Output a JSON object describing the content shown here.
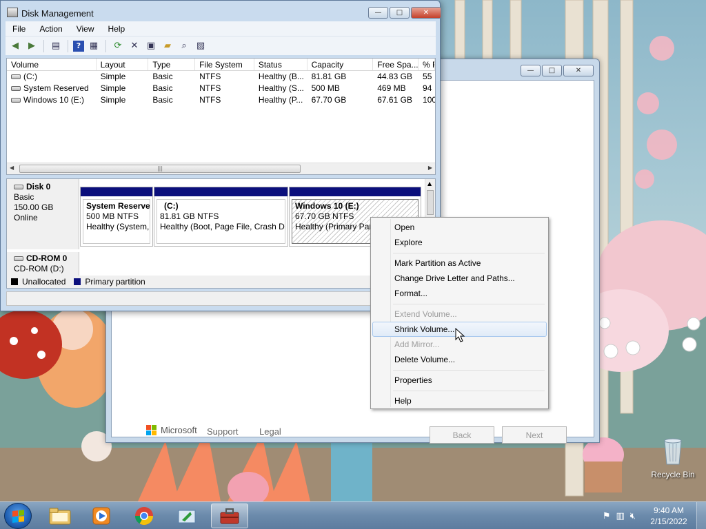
{
  "disk_mgmt": {
    "title": "Disk Management",
    "menu": [
      "File",
      "Action",
      "View",
      "Help"
    ],
    "columns": [
      "Volume",
      "Layout",
      "Type",
      "File System",
      "Status",
      "Capacity",
      "Free Spa...",
      "% F"
    ],
    "volumes": [
      [
        "(C:)",
        "Simple",
        "Basic",
        "NTFS",
        "Healthy (B...",
        "81.81 GB",
        "44.83 GB",
        "55"
      ],
      [
        "System Reserved",
        "Simple",
        "Basic",
        "NTFS",
        "Healthy (S...",
        "500 MB",
        "469 MB",
        "94"
      ],
      [
        "Windows 10 (E:)",
        "Simple",
        "Basic",
        "NTFS",
        "Healthy (P...",
        "67.70 GB",
        "67.61 GB",
        "100"
      ]
    ],
    "disk0": {
      "name": "Disk 0",
      "type": "Basic",
      "size": "150.00 GB",
      "state": "Online",
      "partitions": [
        {
          "name": "System Reserve",
          "info": "500 MB NTFS",
          "status": "Healthy (System,"
        },
        {
          "name": "(C:)",
          "info": "81.81 GB NTFS",
          "status": "Healthy (Boot, Page File, Crash Du"
        },
        {
          "name": "Windows 10  (E:)",
          "info": "67.70 GB NTFS",
          "status": "Healthy (Primary Part"
        }
      ]
    },
    "cdrom": {
      "name": "CD-ROM 0",
      "drive": "CD-ROM (D:)"
    },
    "legend": {
      "unallocated": "Unallocated",
      "primary": "Primary partition"
    },
    "colors": {
      "partition_bar": "#0b0f7c",
      "unallocated": "#000000"
    }
  },
  "context_menu": {
    "items": [
      {
        "label": "Open",
        "disabled": false
      },
      {
        "label": "Explore",
        "disabled": false
      },
      {
        "label": "Mark Partition as Active",
        "disabled": false
      },
      {
        "label": "Change Drive Letter and Paths...",
        "disabled": false
      },
      {
        "label": "Format...",
        "disabled": false
      },
      {
        "label": "Extend Volume...",
        "disabled": true
      },
      {
        "label": "Shrink Volume...",
        "disabled": false,
        "highlighted": true
      },
      {
        "label": "Add Mirror...",
        "disabled": true
      },
      {
        "label": "Delete Volume...",
        "disabled": false
      },
      {
        "label": "Properties",
        "disabled": false
      },
      {
        "label": "Help",
        "disabled": false
      }
    ]
  },
  "setup_window": {
    "brand": "Microsoft",
    "links": [
      "Support",
      "Legal"
    ],
    "buttons": [
      "Back",
      "Next"
    ]
  },
  "desktop": {
    "recycle_bin_label": "Recycle Bin"
  },
  "taskbar": {
    "apps": [
      "explorer-icon",
      "media-player-icon",
      "chrome-icon",
      "setup-icon",
      "toolbox-icon"
    ],
    "clock_time": "9:40 AM",
    "clock_date": "2/15/2022"
  }
}
